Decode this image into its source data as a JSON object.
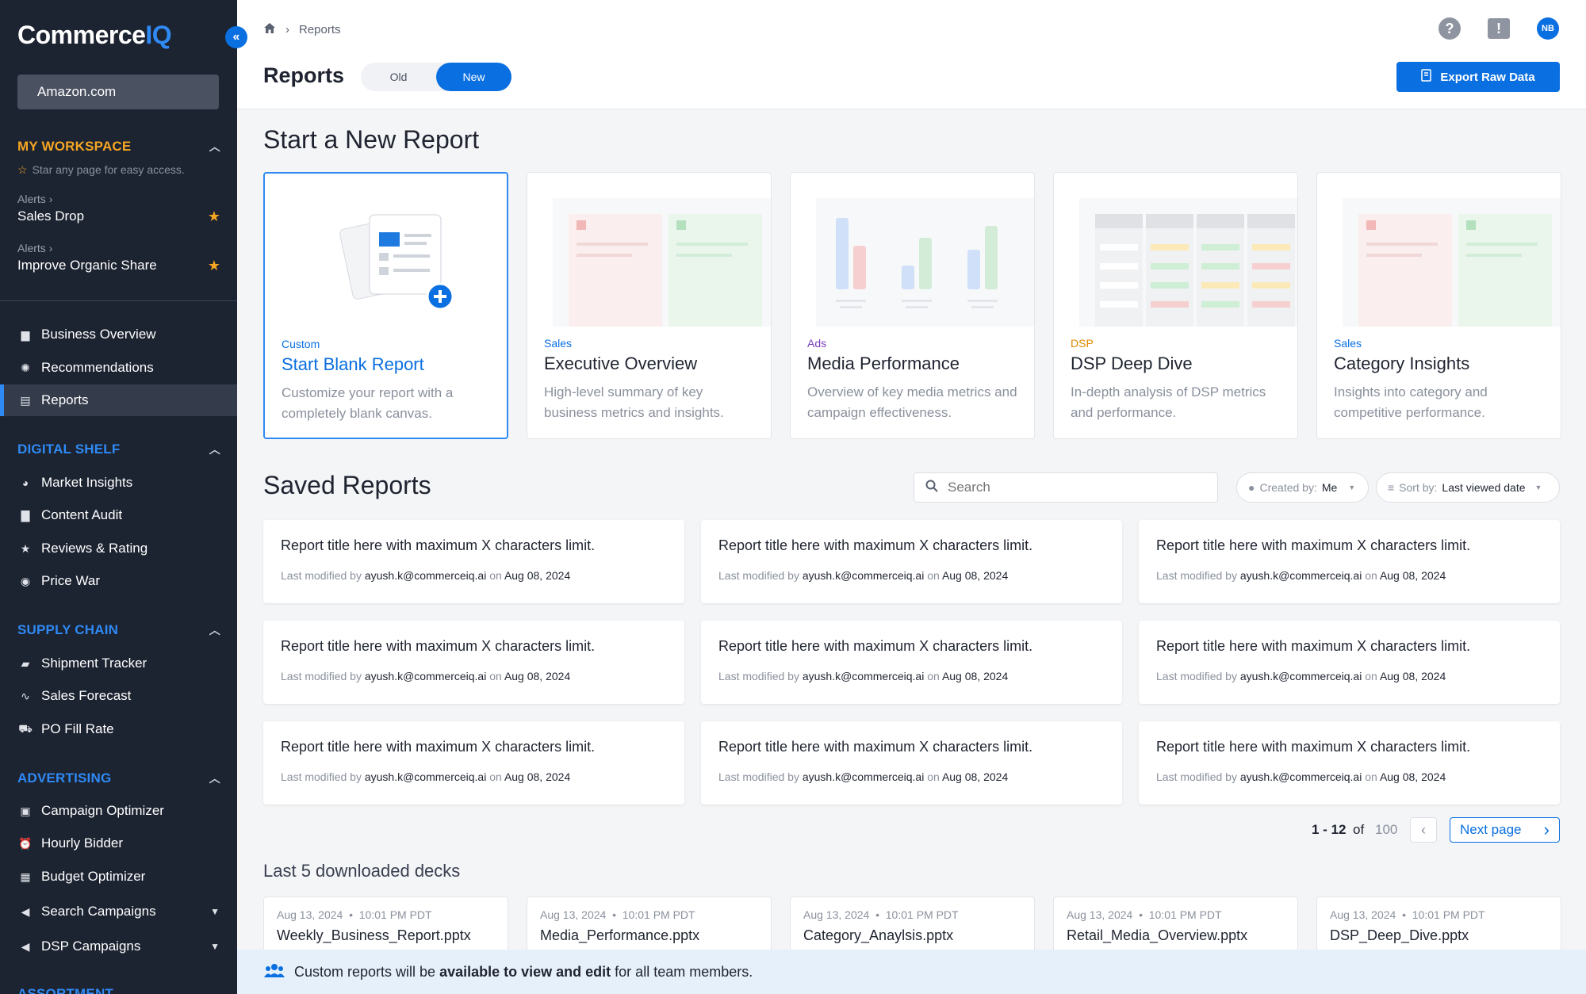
{
  "sidebar": {
    "logo_main": "Commerce",
    "logo_accent": "IQ",
    "collapse_icon": "«",
    "account": "Amazon.com",
    "workspace": {
      "title": "MY WORKSPACE",
      "hint": "Star any page for easy access.",
      "alerts": [
        {
          "label": "Alerts",
          "name": "Sales Drop"
        },
        {
          "label": "Alerts",
          "name": "Improve Organic Share"
        }
      ]
    },
    "main_nav": [
      "Business Overview",
      "Recommendations",
      "Reports"
    ],
    "digital_shelf": {
      "title": "DIGITAL SHELF",
      "items": [
        "Market Insights",
        "Content Audit",
        "Reviews & Rating",
        "Price War"
      ]
    },
    "supply_chain": {
      "title": "SUPPLY CHAIN",
      "items": [
        "Shipment Tracker",
        "Sales Forecast",
        "PO Fill Rate"
      ]
    },
    "advertising": {
      "title": "ADVERTISING",
      "items": [
        "Campaign Optimizer",
        "Hourly Bidder",
        "Budget Optimizer",
        "Search Campaigns",
        "DSP Campaigns"
      ]
    },
    "assortment_title": "ASSORTMENT"
  },
  "header": {
    "breadcrumb": "Reports",
    "title": "Reports",
    "toggle_old": "Old",
    "toggle_new": "New",
    "avatar": "NB",
    "export": "Export Raw Data"
  },
  "start": {
    "title": "Start a New Report",
    "templates": [
      {
        "cat": "Custom",
        "name": "Start Blank Report",
        "desc": "Customize your report with a completely blank canvas.",
        "color": "#0a6fe0"
      },
      {
        "cat": "Sales",
        "name": "Executive Overview",
        "desc": "High-level summary of key business metrics and insights.",
        "color": "#0a6fe0"
      },
      {
        "cat": "Ads",
        "name": "Media Performance",
        "desc": "Overview of key media metrics and campaign effectiveness.",
        "color": "#7a3fbf"
      },
      {
        "cat": "DSP",
        "name": "DSP Deep Dive",
        "desc": "In-depth analysis of DSP metrics and performance.",
        "color": "#e08a00"
      },
      {
        "cat": "Sales",
        "name": "Category Insights",
        "desc": "Insights into category and competitive performance.",
        "color": "#0a6fe0"
      }
    ]
  },
  "saved": {
    "title": "Saved Reports",
    "search_placeholder": "Search",
    "created_label": "Created by:",
    "created_value": "Me",
    "sort_label": "Sort by:",
    "sort_value": "Last viewed date",
    "report_title": "Report title here with maximum X characters limit.",
    "meta_prefix": "Last modified by",
    "meta_user": "ayush.k@commerceiq.ai",
    "meta_on": "on",
    "meta_date": "Aug 08, 2024",
    "pager_range": "1 - 12",
    "pager_of": "of",
    "pager_total": "100",
    "next": "Next page"
  },
  "decks": {
    "title": "Last 5 downloaded decks",
    "items": [
      {
        "date": "Aug 13, 2024",
        "time": "10:01 PM PDT",
        "file": "Weekly_Business_Report.pptx"
      },
      {
        "date": "Aug 13, 2024",
        "time": "10:01 PM PDT",
        "file": "Media_Performance.pptx"
      },
      {
        "date": "Aug 13, 2024",
        "time": "10:01 PM PDT",
        "file": "Category_Anaylsis.pptx"
      },
      {
        "date": "Aug 13, 2024",
        "time": "10:01 PM PDT",
        "file": "Retail_Media_Overview.pptx"
      },
      {
        "date": "Aug 13, 2024",
        "time": "10:01 PM PDT",
        "file": "DSP_Deep_Dive.pptx"
      }
    ]
  },
  "banner": {
    "pre": "Custom reports will be",
    "bold": "available to view and edit",
    "post": "for all team members."
  }
}
